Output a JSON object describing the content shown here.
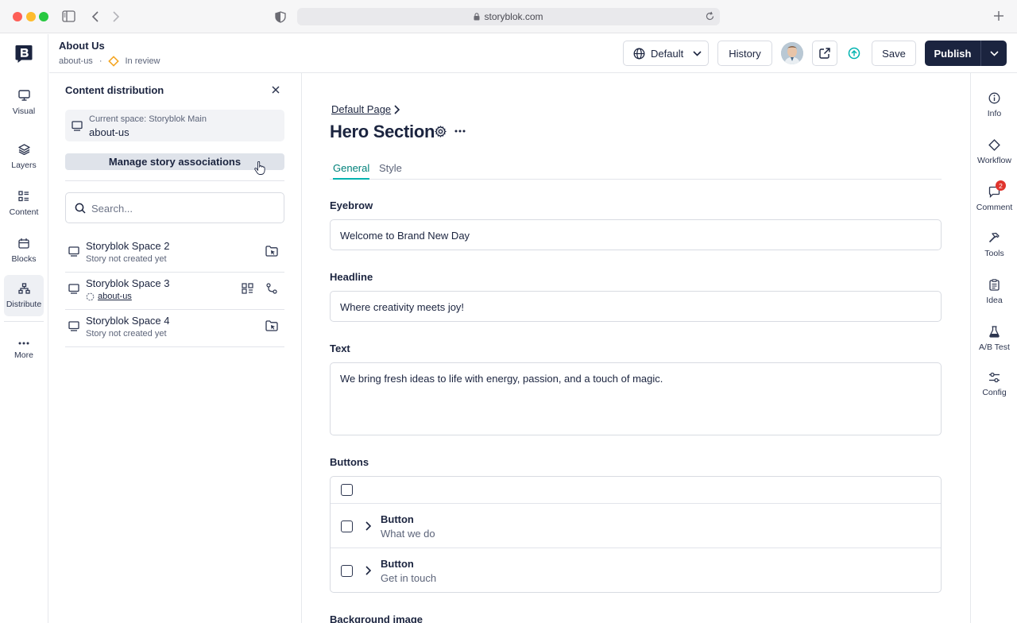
{
  "browser": {
    "url": "storyblok.com"
  },
  "rail": {
    "items": [
      {
        "label": "Visual"
      },
      {
        "label": "Layers"
      },
      {
        "label": "Content"
      },
      {
        "label": "Blocks"
      },
      {
        "label": "Distribute"
      },
      {
        "label": "More"
      }
    ]
  },
  "header": {
    "story_title": "About Us",
    "slug": "about-us",
    "separator": "·",
    "status": "In review",
    "language_label": "Default",
    "history_label": "History",
    "save_label": "Save",
    "publish_label": "Publish"
  },
  "panel": {
    "title": "Content distribution",
    "current_space_label": "Current space: Storyblok Main",
    "current_space_slug": "about-us",
    "manage_label": "Manage story associations",
    "search_placeholder": "Search...",
    "spaces": [
      {
        "name": "Storyblok Space 2",
        "sub": "Story not created yet"
      },
      {
        "name": "Storyblok Space 3",
        "sub": "about-us"
      },
      {
        "name": "Storyblok Space 4",
        "sub": "Story not created yet"
      }
    ]
  },
  "editor": {
    "breadcrumb": "Default Page",
    "block_title": "Hero Section",
    "tabs": [
      {
        "label": "General"
      },
      {
        "label": "Style"
      }
    ],
    "fields": {
      "eyebrow_label": "Eyebrow",
      "eyebrow_value": "Welcome to Brand New Day",
      "headline_label": "Headline",
      "headline_value": "Where creativity meets joy!",
      "text_label": "Text",
      "text_value": "We bring fresh ideas to life with energy, passion, and a touch of magic.",
      "buttons_label": "Buttons",
      "background_label": "Background image"
    },
    "buttons": [
      {
        "type": "Button",
        "label": "What we do"
      },
      {
        "type": "Button",
        "label": "Get in touch"
      }
    ]
  },
  "right_rail": {
    "items": [
      {
        "label": "Info"
      },
      {
        "label": "Workflow"
      },
      {
        "label": "Comment",
        "badge": "2"
      },
      {
        "label": "Tools"
      },
      {
        "label": "Idea"
      },
      {
        "label": "A/B Test"
      },
      {
        "label": "Config"
      }
    ]
  },
  "colors": {
    "primary_dark": "#1b243f",
    "accent_teal": "#00b3b0",
    "status_orange": "#f5a623",
    "badge_red": "#e0342d"
  }
}
